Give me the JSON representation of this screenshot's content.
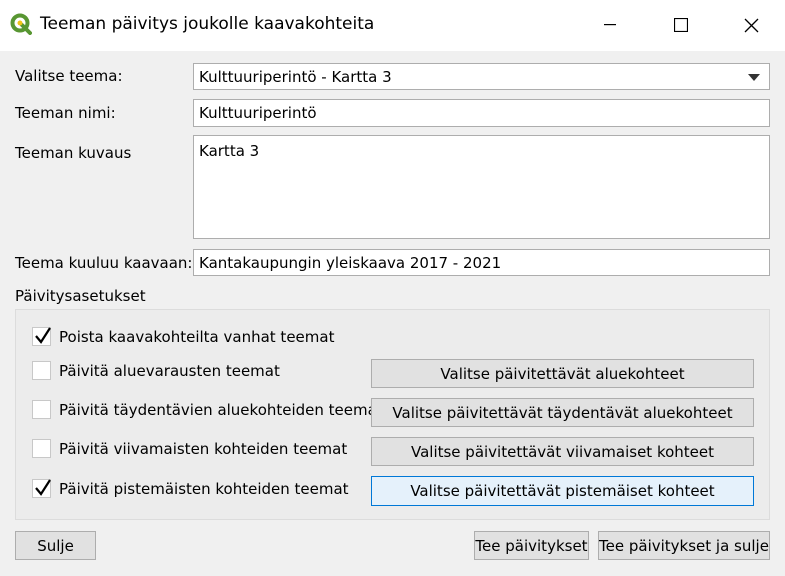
{
  "window": {
    "title": "Teeman päivitys joukolle kaavakohteita"
  },
  "form": {
    "theme_select_label": "Valitse teema:",
    "theme_select_value": "Kulttuuriperintö - Kartta 3",
    "theme_name_label": "Teeman nimi:",
    "theme_name_value": "Kulttuuriperintö",
    "theme_desc_label": "Teeman kuvaus",
    "theme_desc_value": "Kartta 3",
    "theme_plan_label": "Teema kuuluu kaavaan:",
    "theme_plan_value": "Kantakaupungin yleiskaava 2017 - 2021"
  },
  "update_settings": {
    "title": "Päivitysasetukset",
    "rows": [
      {
        "label": "Poista kaavakohteilta vanhat teemat",
        "checked": true
      },
      {
        "label": "Päivitä aluevarausten teemat",
        "checked": false,
        "button": "Valitse päivitettävät aluekohteet"
      },
      {
        "label": "Päivitä täydentävien aluekohteiden teemat",
        "checked": false,
        "button": "Valitse päivitettävät täydentävät aluekohteet"
      },
      {
        "label": "Päivitä viivamaisten kohteiden teemat",
        "checked": false,
        "button": "Valitse päivitettävät viivamaiset kohteet"
      },
      {
        "label": "Päivitä pistemäisten kohteiden teemat",
        "checked": true,
        "button": "Valitse päivitettävät pistemäiset kohteet"
      }
    ]
  },
  "footer": {
    "close": "Sulje",
    "apply": "Tee päivitykset",
    "apply_close": "Tee päivitykset ja sulje"
  },
  "colors": {
    "accent": "#0078d7",
    "qgis_green": "#589632",
    "qgis_yellow": "#f0c419"
  },
  "icons": {
    "app": "qgis-logo-icon",
    "minimize": "minimize-icon",
    "maximize": "maximize-icon",
    "close": "close-icon",
    "check": "checkmark-icon",
    "combo": "chevron-down-icon"
  }
}
